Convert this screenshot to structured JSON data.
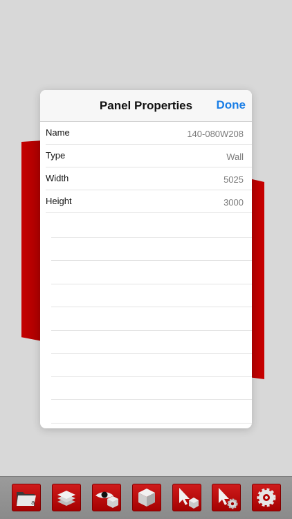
{
  "panel": {
    "title": "Panel Properties",
    "done_label": "Done",
    "rows": [
      {
        "label": "Name",
        "value": "140-080W208"
      },
      {
        "label": "Type",
        "value": "Wall"
      },
      {
        "label": "Width",
        "value": "5025"
      },
      {
        "label": "Height",
        "value": "3000"
      }
    ]
  },
  "toolbar": {
    "tools": [
      {
        "icon": "folder-icon"
      },
      {
        "icon": "layers-icon"
      },
      {
        "icon": "eye-icon"
      },
      {
        "icon": "cube-icon"
      },
      {
        "icon": "select-cursor-icon"
      },
      {
        "icon": "cursor-settings-icon"
      },
      {
        "icon": "gear-icon"
      }
    ]
  },
  "colors": {
    "accent": "#1a7ee6",
    "tool_red": "#c00000",
    "wall_red": "#b80000"
  }
}
